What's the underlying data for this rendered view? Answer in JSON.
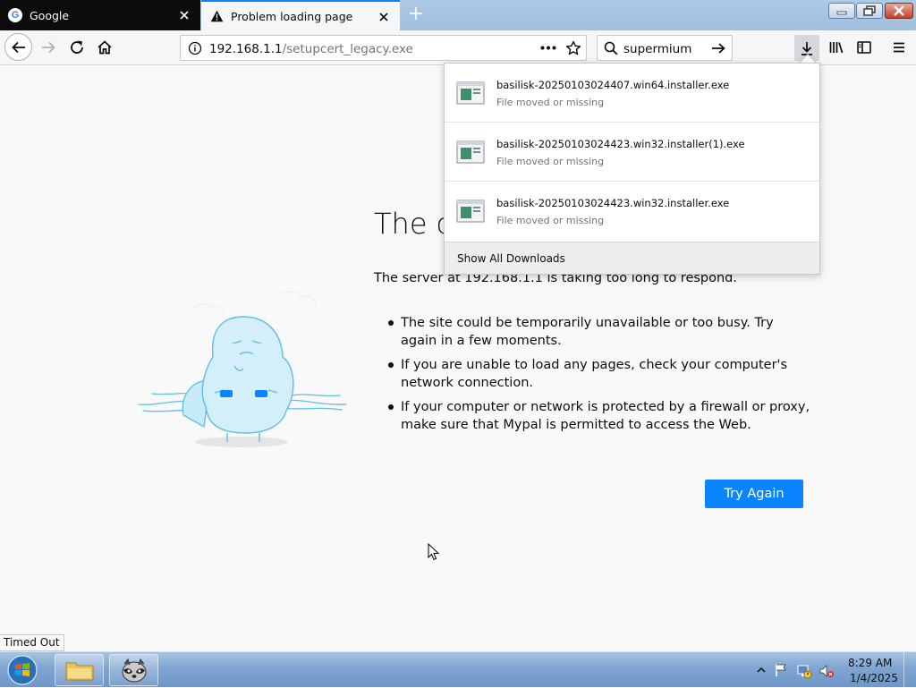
{
  "tabs": [
    {
      "title": "Google",
      "icon": "google-icon"
    },
    {
      "title": "Problem loading page",
      "icon": "warning-icon"
    }
  ],
  "nav": {
    "url_host": "192.168.1.1",
    "url_path": "/setupcert_legacy.exe",
    "search_value": "supermium"
  },
  "error": {
    "title": "The c",
    "description": "The server at 192.168.1.1 is taking too long to respond.",
    "suggestions": [
      "The site could be temporarily unavailable or too busy. Try again in a few moments.",
      "If you are unable to load any pages, check your computer's network connection.",
      "If your computer or network is protected by a firewall or proxy, make sure that Mypal is permitted to access the Web."
    ],
    "button": "Try Again"
  },
  "downloads": {
    "items": [
      {
        "name": "basilisk-20250103024407.win64.installer.exe",
        "status": "File moved or missing"
      },
      {
        "name": "basilisk-20250103024423.win32.installer(1).exe",
        "status": "File moved or missing"
      },
      {
        "name": "basilisk-20250103024423.win32.installer.exe",
        "status": "File moved or missing"
      }
    ],
    "footer": "Show All Downloads"
  },
  "status": "Timed Out",
  "taskbar": {
    "time": "8:29 AM",
    "date": "1/4/2025"
  },
  "colors": {
    "accent": "#0a84ff",
    "tab_dark": "#0c0c0d",
    "illustration": "#5bbfe6"
  }
}
